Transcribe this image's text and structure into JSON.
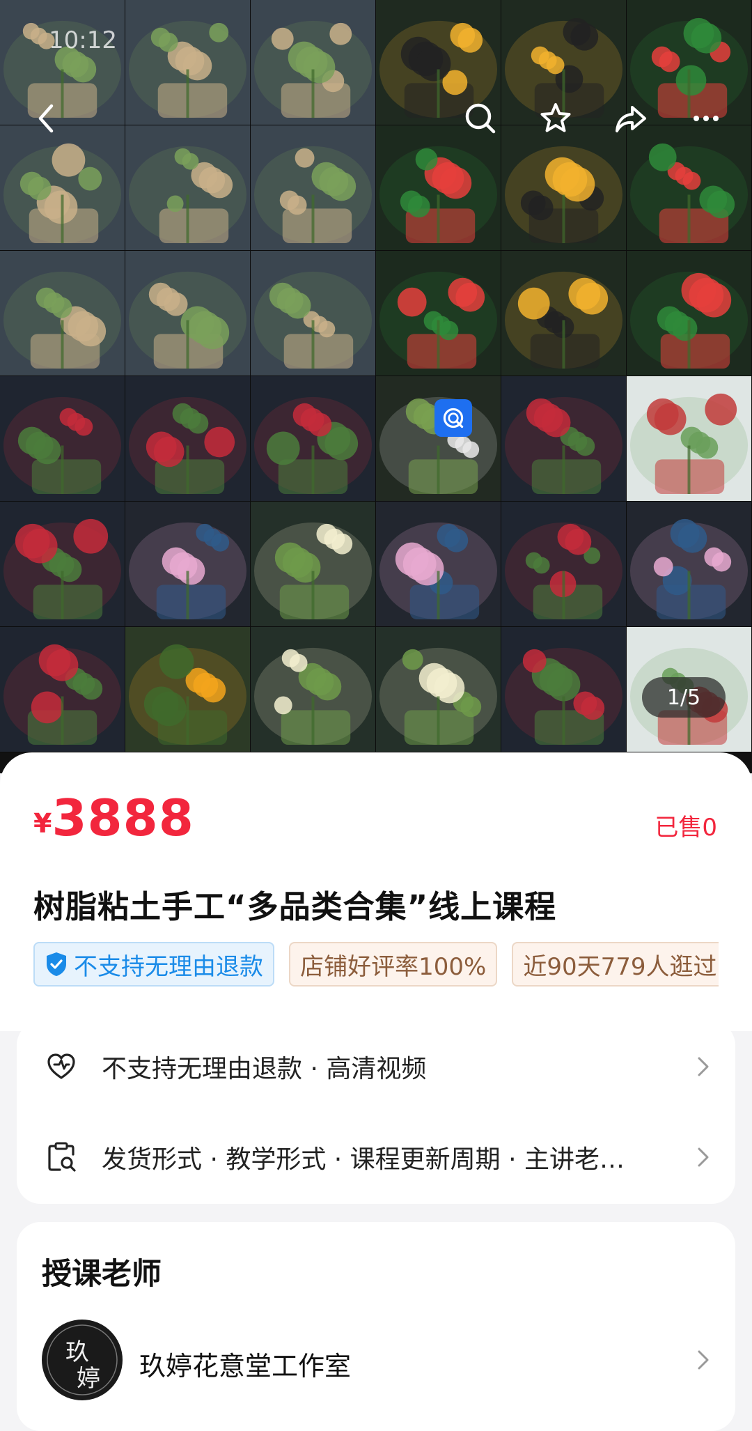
{
  "status_bar": {
    "time": "10:12"
  },
  "gallery": {
    "page_indicator": "1/5",
    "tiles": [
      "succulent-pot",
      "succulent-cluster",
      "air-plant",
      "watermelon-cake",
      "cone-cake",
      "watermelon-doll",
      "air-plant-red",
      "red-succulent",
      "zebra-succulent",
      "watermelon-cups",
      "cone-cake",
      "watermelon-slices",
      "peach-succulent",
      "green-succulent",
      "pink-succulent",
      "watermelon-doll",
      "cone-cake",
      "watermelon-slice",
      "red-branch",
      "dahlia",
      "red-peony",
      "dandelion",
      "red-branch-vase",
      "strawberry-plant",
      "hydrangea",
      "magnolia-vase",
      "daisy",
      "pink-blossom",
      "rose",
      "lotus",
      "tulip",
      "sunflower",
      "orchid",
      "lily",
      "plum-bonsai",
      "vase-plant"
    ]
  },
  "top_icons": [
    "back-icon",
    "search-icon",
    "star-icon",
    "share-icon",
    "more-icon"
  ],
  "product": {
    "currency": "¥",
    "price": "3888",
    "sold": "已售0",
    "title": "树脂粘土手工“多品类合集”线上课程",
    "tags": [
      "不支持无理由退款",
      "店铺好评率100%",
      "近90天779人逛过"
    ]
  },
  "details": {
    "service_row": "不支持无理由退款 · 高清视频",
    "params_row": "发货形式 · 教学形式 · 课程更新周期 · 主讲老…"
  },
  "teacher": {
    "section_title": "授课老师",
    "name": "玖婷花意堂工作室",
    "avatar_text": "玖婷"
  },
  "colors": {
    "accent": "#f2263d",
    "tag_blue": "#1a8be8",
    "tag_sand": "#8c5d3c"
  }
}
